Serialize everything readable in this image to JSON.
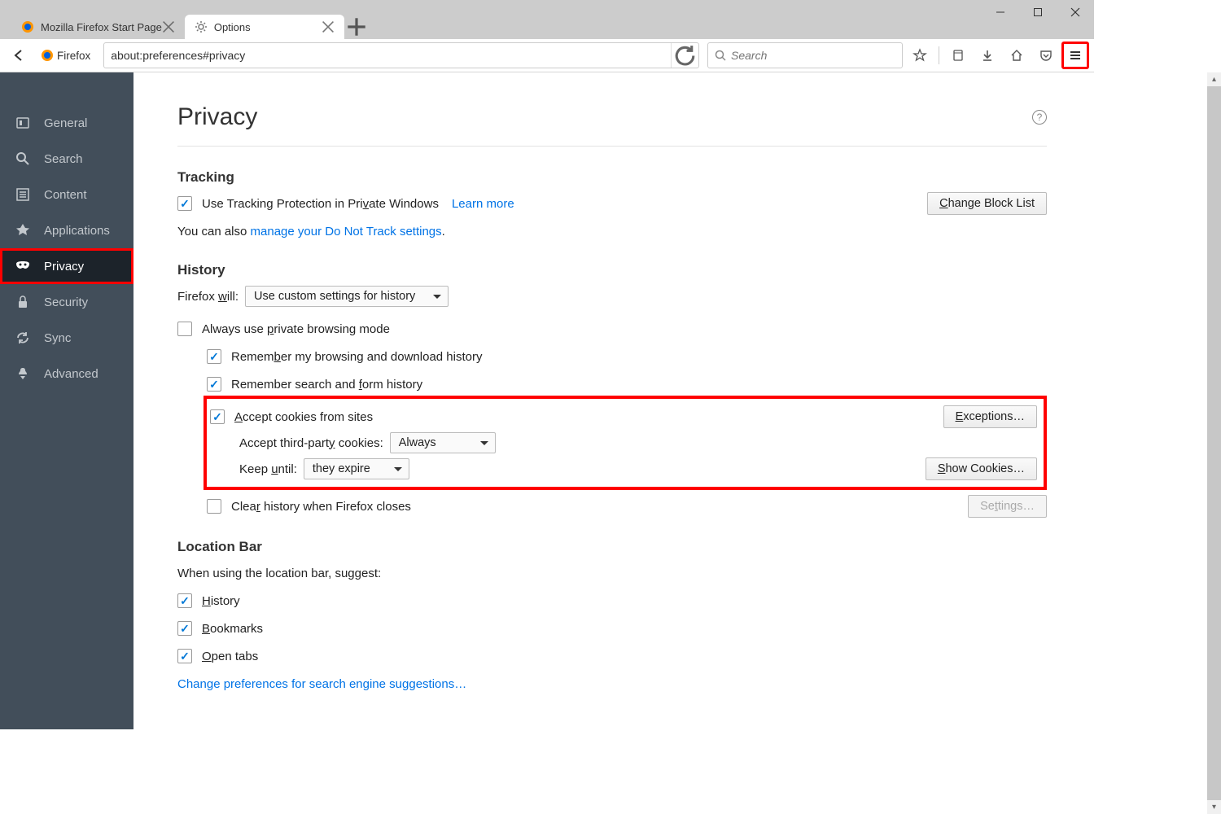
{
  "window": {
    "min": "—",
    "max": "▢",
    "close": "✕"
  },
  "tabs": [
    {
      "title": "Mozilla Firefox Start Page",
      "active": false
    },
    {
      "title": "Options",
      "active": true
    }
  ],
  "identity": {
    "name": "Firefox"
  },
  "url": "about:preferences#privacy",
  "search_placeholder": "Search",
  "sidebar": [
    {
      "id": "general",
      "label": "General"
    },
    {
      "id": "search",
      "label": "Search"
    },
    {
      "id": "content",
      "label": "Content"
    },
    {
      "id": "applications",
      "label": "Applications"
    },
    {
      "id": "privacy",
      "label": "Privacy",
      "selected": true
    },
    {
      "id": "security",
      "label": "Security"
    },
    {
      "id": "sync",
      "label": "Sync"
    },
    {
      "id": "advanced",
      "label": "Advanced"
    }
  ],
  "page": {
    "title": "Privacy",
    "tracking": {
      "heading": "Tracking",
      "checkbox_label_pre": "Use Tracking Protection in Pri",
      "checkbox_label_u": "v",
      "checkbox_label_post": "ate Windows",
      "learn_more": "Learn more",
      "change_block_pre": "C",
      "change_block_post": "hange Block List",
      "also_pre": "You can also ",
      "also_link": "manage your Do Not Track settings",
      "also_post": "."
    },
    "history": {
      "heading": "History",
      "will_pre": "Firefox ",
      "will_u": "w",
      "will_post": "ill:",
      "mode_select": "Use custom settings for history",
      "private_pre": "Always use ",
      "private_u": "p",
      "private_post": "rivate browsing mode",
      "remember_pre": "Remem",
      "remember_u": "b",
      "remember_post": "er my browsing and download history",
      "searchform_pre": "Remember search and ",
      "searchform_u": "f",
      "searchform_post": "orm history",
      "accept_pre": "A",
      "accept_u": "",
      "accept_label": "ccept cookies from sites",
      "accept_full_pre": "",
      "accept_full": "Accept cookies from sites",
      "exceptions_pre": "E",
      "exceptions_post": "xceptions…",
      "third_pre": "Accept third-part",
      "third_u": "y",
      "third_post": " cookies:",
      "third_select": "Always",
      "keep_pre": "Keep ",
      "keep_u": "u",
      "keep_post": "ntil:",
      "keep_select": "they expire",
      "show_pre": "S",
      "show_post": "how Cookies…",
      "clear_pre": "Clea",
      "clear_u": "r",
      "clear_post": " history when Firefox closes",
      "settings_pre": "Se",
      "settings_u": "t",
      "settings_post": "tings…"
    },
    "location": {
      "heading": "Location Bar",
      "intro": "When using the location bar, suggest:",
      "hist_pre": "",
      "hist_u": "H",
      "hist_post": "istory",
      "book_pre": "B",
      "book_u": "",
      "book_post": "ookmarks",
      "book_full": "Bookmarks",
      "open_pre": "",
      "open_u": "O",
      "open_post": "pen tabs",
      "change_link": "Change preferences for search engine suggestions…"
    }
  }
}
